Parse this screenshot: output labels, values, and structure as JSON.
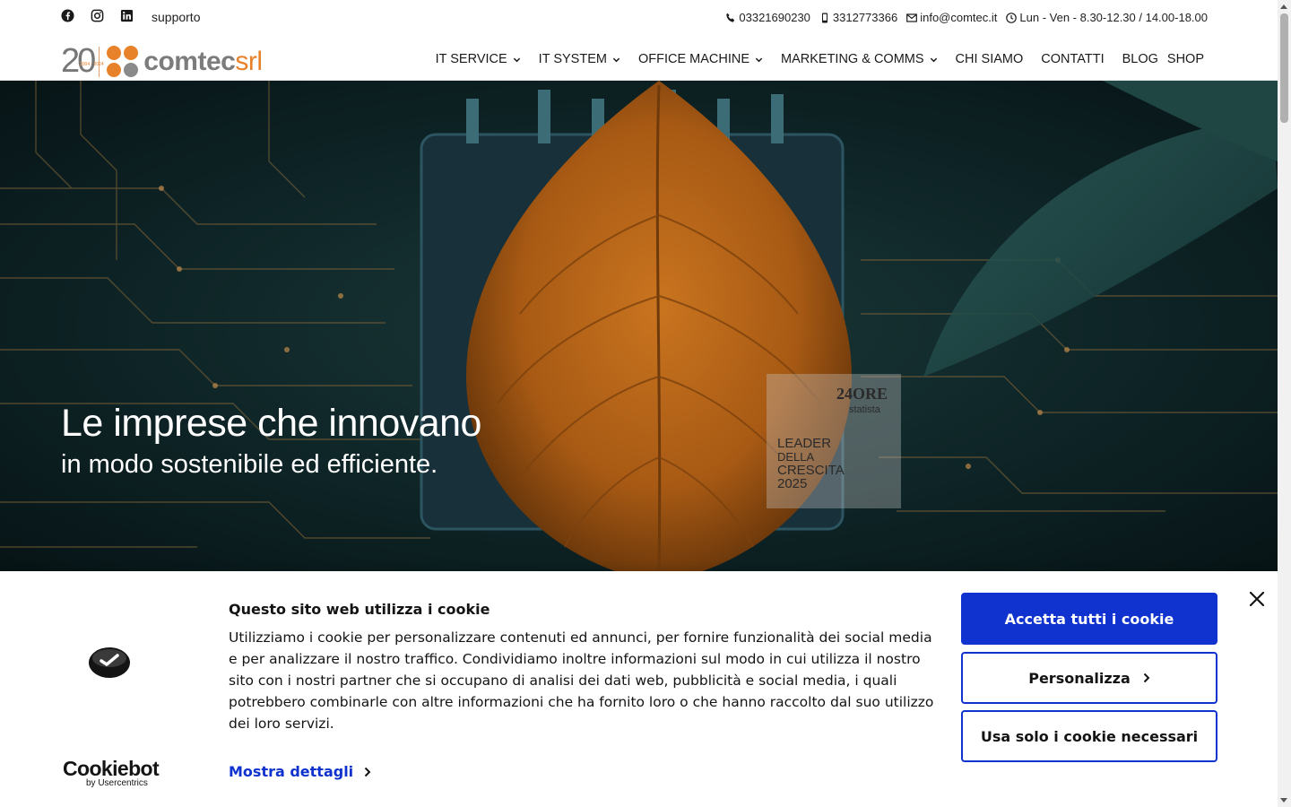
{
  "topbar": {
    "social": [
      {
        "icon": "facebook-icon"
      },
      {
        "icon": "instagram-icon"
      },
      {
        "icon": "linkedin-icon"
      }
    ],
    "support_link": "supporto",
    "phone": "03321690230",
    "mobile": "3312773366",
    "email": "info@comtec.it",
    "hours": "Lun - Ven - 8.30-12.30 / 14.00-18.00"
  },
  "header": {
    "logo": {
      "anniversary": "20",
      "years": "2004 - 2024",
      "brand": "comtec",
      "suffix": "srl",
      "colors": {
        "orange": "#e8822a",
        "gray": "#7c7c7c"
      }
    },
    "nav": [
      {
        "label": "IT SERVICE",
        "dropdown": true
      },
      {
        "label": "IT SYSTEM",
        "dropdown": true
      },
      {
        "label": "OFFICE MACHINE",
        "dropdown": true
      },
      {
        "label": "MARKETING & COMMS",
        "dropdown": true
      },
      {
        "label": "CHI SIAMO",
        "dropdown": false
      },
      {
        "label": "CONTATTI",
        "dropdown": false
      },
      {
        "label": "BLOG",
        "dropdown": false
      },
      {
        "label": "SHOP",
        "dropdown": false
      }
    ]
  },
  "hero": {
    "title": "Le imprese che innovano",
    "subtitle": "in modo sostenibile ed efficiente.",
    "badge": {
      "publisher": "24ORE",
      "partner": "statista",
      "line1": "LEADER",
      "line2": "DELLA",
      "line3": "CRESCITA",
      "year": "2025"
    }
  },
  "cookie_banner": {
    "title": "Questo sito web utilizza i cookie",
    "text": "Utilizziamo i cookie per personalizzare contenuti ed annunci, per fornire funzionalità dei social media e per analizzare il nostro traffico. Condividiamo inoltre informazioni sul modo in cui utilizza il nostro sito con i nostri partner che si occupano di analisi dei dati web, pubblicità e social media, i quali potrebbero combinarle con altre informazioni che ha fornito loro o che hanno raccolto dal suo utilizzo dei loro servizi.",
    "details_link": "Mostra dettagli",
    "provider": "Cookiebot",
    "provider_by": "by Usercentrics",
    "accept_all": "Accetta tutti i cookie",
    "customize": "Personalizza",
    "necessary_only": "Usa solo i cookie necessari",
    "accent_color": "#1032cf"
  }
}
